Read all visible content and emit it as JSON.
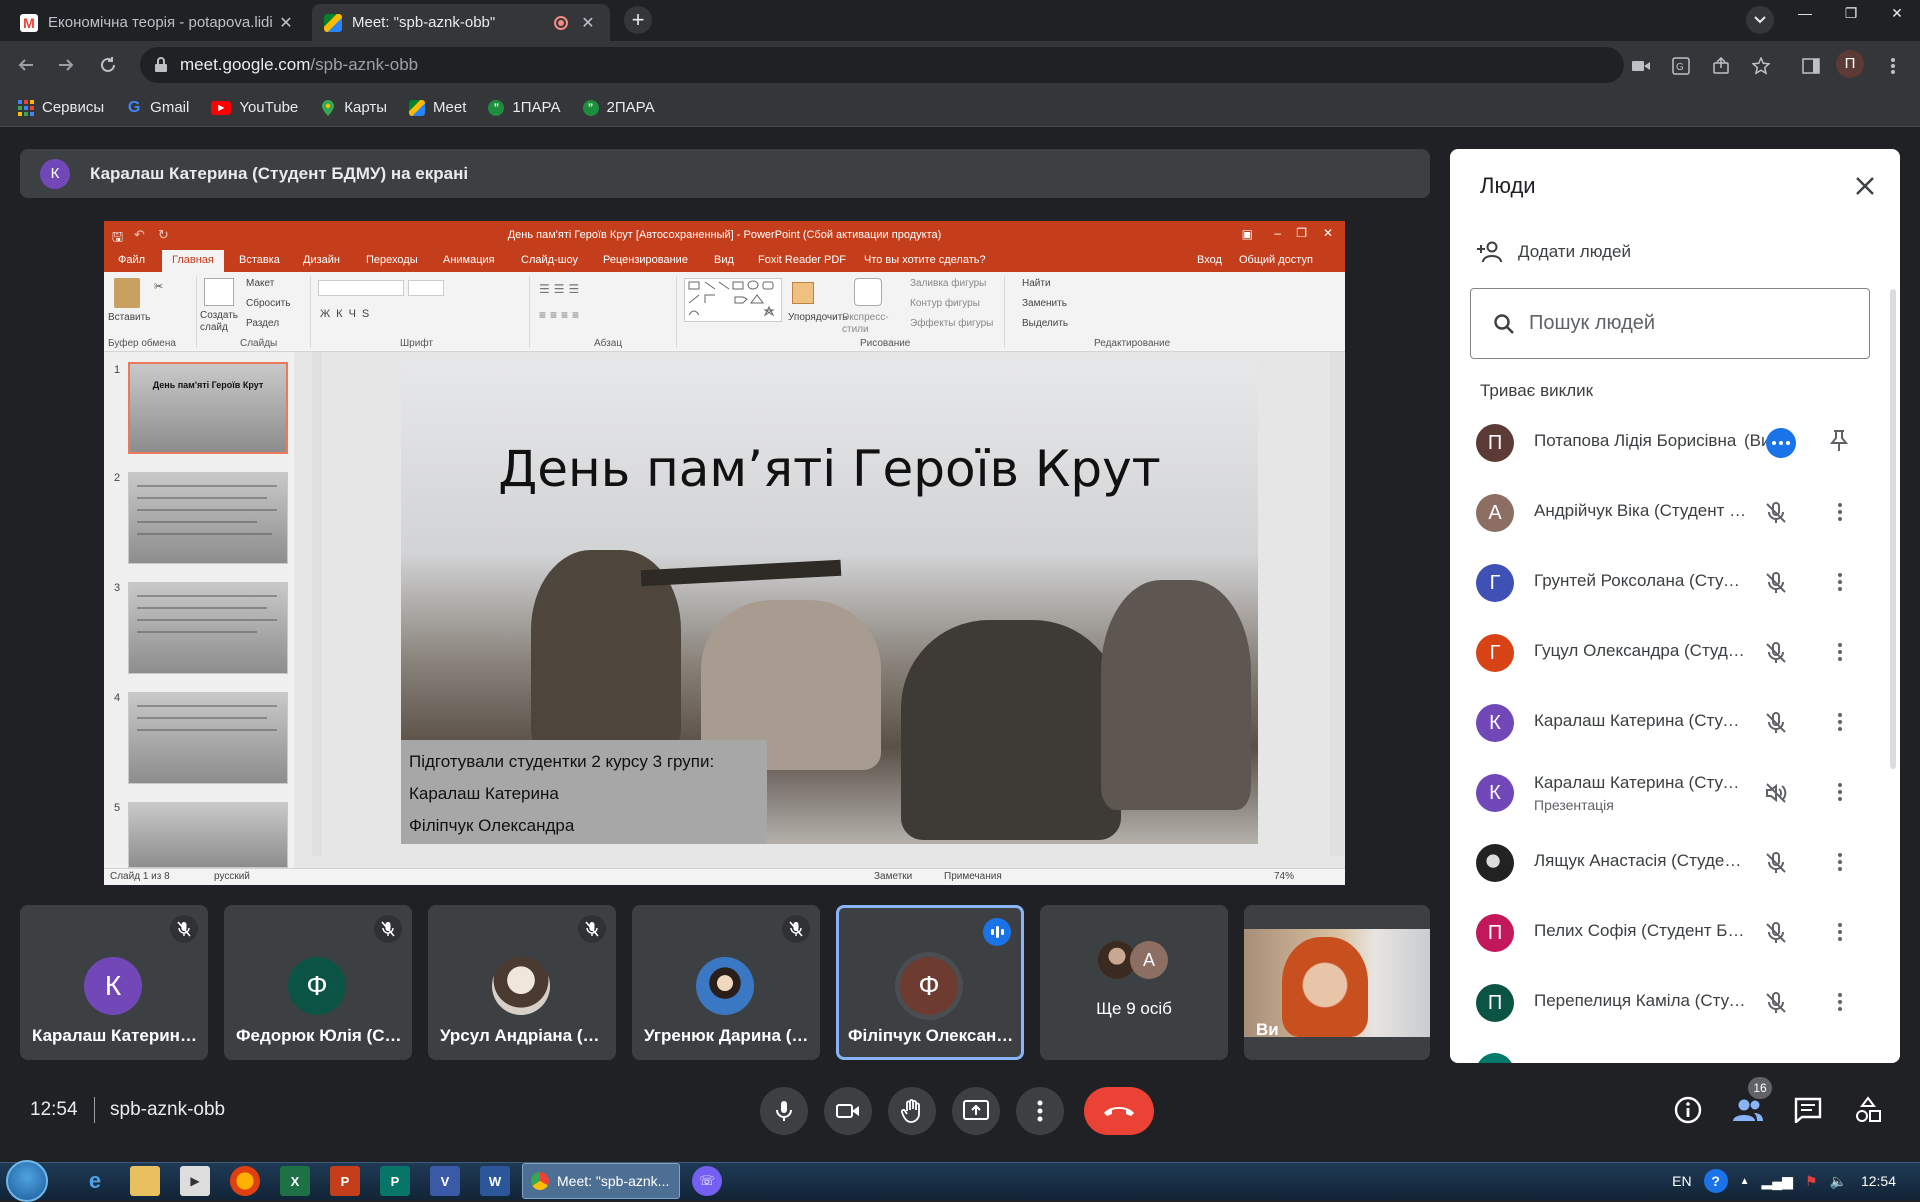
{
  "browser": {
    "tabs": [
      {
        "title": "Економічна теорія - potapova.lidi",
        "favicon": "gmail-icon"
      },
      {
        "title": "Meet: \"spb-aznk-obb\"",
        "favicon": "meet-icon",
        "recording": true
      }
    ],
    "url_host": "meet.google.com",
    "url_path": "/spb-aznk-obb",
    "profile_initial": "П",
    "bookmarks": [
      {
        "label": "Сервисы",
        "icon": "apps-grid-icon"
      },
      {
        "label": "Gmail",
        "icon": "google-icon"
      },
      {
        "label": "YouTube",
        "icon": "youtube-icon"
      },
      {
        "label": "Карты",
        "icon": "maps-pin-icon"
      },
      {
        "label": "Meet",
        "icon": "meet-icon"
      },
      {
        "label": "1ПАРА",
        "icon": "chat-icon"
      },
      {
        "label": "2ПАРА",
        "icon": "chat-icon"
      }
    ]
  },
  "presentation_banner": {
    "initial": "К",
    "text": "Каралаш Катерина (Студент БДМУ) на екрані"
  },
  "powerpoint": {
    "title": "День пам'яті Героїв Крут [Автосохраненный] - PowerPoint (Сбой активации продукта)",
    "tabs": [
      "Файл",
      "Главная",
      "Вставка",
      "Дизайн",
      "Переходы",
      "Анимация",
      "Слайд-шоу",
      "Рецензирование",
      "Вид",
      "Foxit Reader PDF",
      "Что вы хотите сделать?"
    ],
    "login": "Вход",
    "share": "Общий доступ",
    "ribbon": {
      "paste": "Вставить",
      "new_slide": "Создать слайд",
      "layout": "Макет",
      "reset": "Сбросить",
      "section": "Раздел",
      "arrange": "Упорядочить",
      "quick_styles": "Экспресс-стили",
      "shape_fill": "Заливка фигуры",
      "shape_outline": "Контур фигуры",
      "shape_effects": "Эффекты фигуры",
      "find": "Найти",
      "replace": "Заменить",
      "select": "Выделить",
      "groups": [
        "Буфер обмена",
        "Слайды",
        "Шрифт",
        "Абзац",
        "Рисование",
        "Редактирование"
      ]
    },
    "thumbnails": [
      {
        "num": "1",
        "title": "День пам'яті Героїв Крут"
      },
      {
        "num": "2"
      },
      {
        "num": "3"
      },
      {
        "num": "4"
      },
      {
        "num": "5"
      }
    ],
    "slide": {
      "title": "День пам’яті Героїв Крут",
      "lines": [
        "Підготували студентки 2 курсу 3 групи:",
        "Каралаш Катерина",
        "Філіпчук Олександра"
      ]
    },
    "status": {
      "slide_of": "Слайд 1 из 8",
      "language": "русский",
      "notes": "Заметки",
      "comments": "Примечания",
      "zoom": "74%"
    }
  },
  "tiles": [
    {
      "name": "Каралаш Катерина (Студент БДМУ)",
      "initial": "К",
      "color": "#7248b9",
      "muted": true
    },
    {
      "name": "Федорюк Юлія (Студент БДМУ)",
      "initial": "Ф",
      "color": "#0b5345",
      "muted": true
    },
    {
      "name": "Урсул Андріана (Студент БДМУ)",
      "initial": "",
      "color": "#c8c8c8",
      "muted": true,
      "photo": true
    },
    {
      "name": "Угренюк Дарина (Студент БДМУ)",
      "initial": "",
      "color": "#3b78c4",
      "muted": true,
      "photo": true
    },
    {
      "name": "Філіпчук Олександра (Студент БДМУ)",
      "initial": "Ф",
      "color": "#6d3b30",
      "speaking": true
    },
    {
      "more_label": "Ще 9 осіб",
      "initial": "А"
    },
    {
      "name": "Ви",
      "self_view": true
    }
  ],
  "bottom_bar": {
    "time": "12:54",
    "meeting_code": "spb-aznk-obb",
    "participants_count": "16"
  },
  "people_panel": {
    "title": "Люди",
    "add_people": "Додати людей",
    "search_placeholder": "Пошук людей",
    "section": "Триває виклик",
    "participants": [
      {
        "name": "Потапова Лідія Борисівна",
        "you": "(Ви)",
        "initial": "П",
        "color": "#5c3b36",
        "self": true
      },
      {
        "name": "Андрійчук Віка (Студент БДМУ)",
        "initial": "А",
        "color": "#8d6e63"
      },
      {
        "name": "Грунтей Роксолана (Студент БДМУ)",
        "initial": "Г",
        "color": "#3f51b5"
      },
      {
        "name": "Гуцул Олександра (Студент БДМУ)",
        "initial": "Г",
        "color": "#d84315"
      },
      {
        "name": "Каралаш Катерина (Студент БДМУ)",
        "initial": "К",
        "color": "#7248b9"
      },
      {
        "name": "Каралаш Катерина (Студент БДМУ)",
        "sub": "Презентація",
        "initial": "К",
        "color": "#7248b9",
        "presentation": true
      },
      {
        "name": "Лящук Анастасія (Студент БДМУ)",
        "initial": "",
        "color": "#333333",
        "photo": true
      },
      {
        "name": "Пелих Софія (Студент БДМУ)",
        "initial": "П",
        "color": "#c2185b"
      },
      {
        "name": "Перепелиця Каміла (Студент БДМУ)",
        "initial": "П",
        "color": "#0b5345"
      }
    ]
  },
  "taskbar": {
    "chrome_item": "Meet: \"spb-aznk...",
    "lang": "EN",
    "time": "12:54"
  }
}
